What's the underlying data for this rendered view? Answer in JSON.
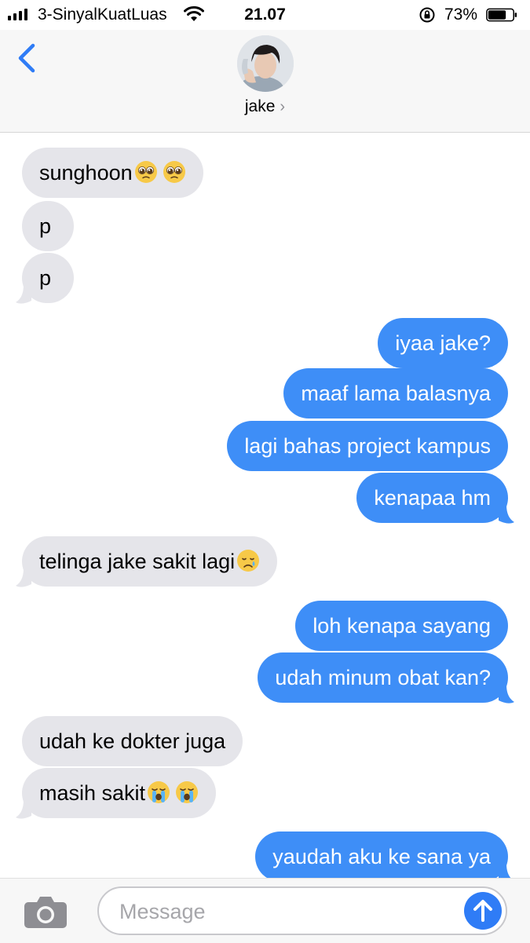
{
  "status_bar": {
    "carrier": "3-SinyalKuatLuas",
    "time": "21.07",
    "battery_percent": "73%",
    "battery_level": 0.73
  },
  "header": {
    "contact_name": "jake",
    "avatar_icon": "contact-photo"
  },
  "messages": [
    {
      "side": "in",
      "text": "sunghoon",
      "emoji": [
        "pleading-face-emoji",
        "pleading-face-emoji"
      ]
    },
    {
      "side": "in",
      "text": "p"
    },
    {
      "side": "in",
      "text": "p"
    },
    {
      "side": "out",
      "text": "iyaa jake?"
    },
    {
      "side": "out",
      "text": "maaf lama balasnya"
    },
    {
      "side": "out",
      "text": "lagi bahas project kampus"
    },
    {
      "side": "out",
      "text": "kenapaa hm"
    },
    {
      "side": "in",
      "text": "telinga jake sakit lagi",
      "emoji": [
        "crying-face-emoji"
      ]
    },
    {
      "side": "out",
      "text": "loh kenapa sayang"
    },
    {
      "side": "out",
      "text": "udah minum obat kan?"
    },
    {
      "side": "in",
      "text": "udah ke dokter juga"
    },
    {
      "side": "in",
      "text": "masih sakit",
      "emoji": [
        "loudly-crying-face-emoji",
        "loudly-crying-face-emoji"
      ]
    },
    {
      "side": "out",
      "text": "yaudah aku ke sana ya"
    }
  ],
  "input_bar": {
    "placeholder": "Message",
    "value": ""
  },
  "colors": {
    "outgoing_bubble": "#3e8ef7",
    "incoming_bubble": "#e5e5ea",
    "accent": "#2f7cf6",
    "header_bg": "#f7f7f7"
  }
}
